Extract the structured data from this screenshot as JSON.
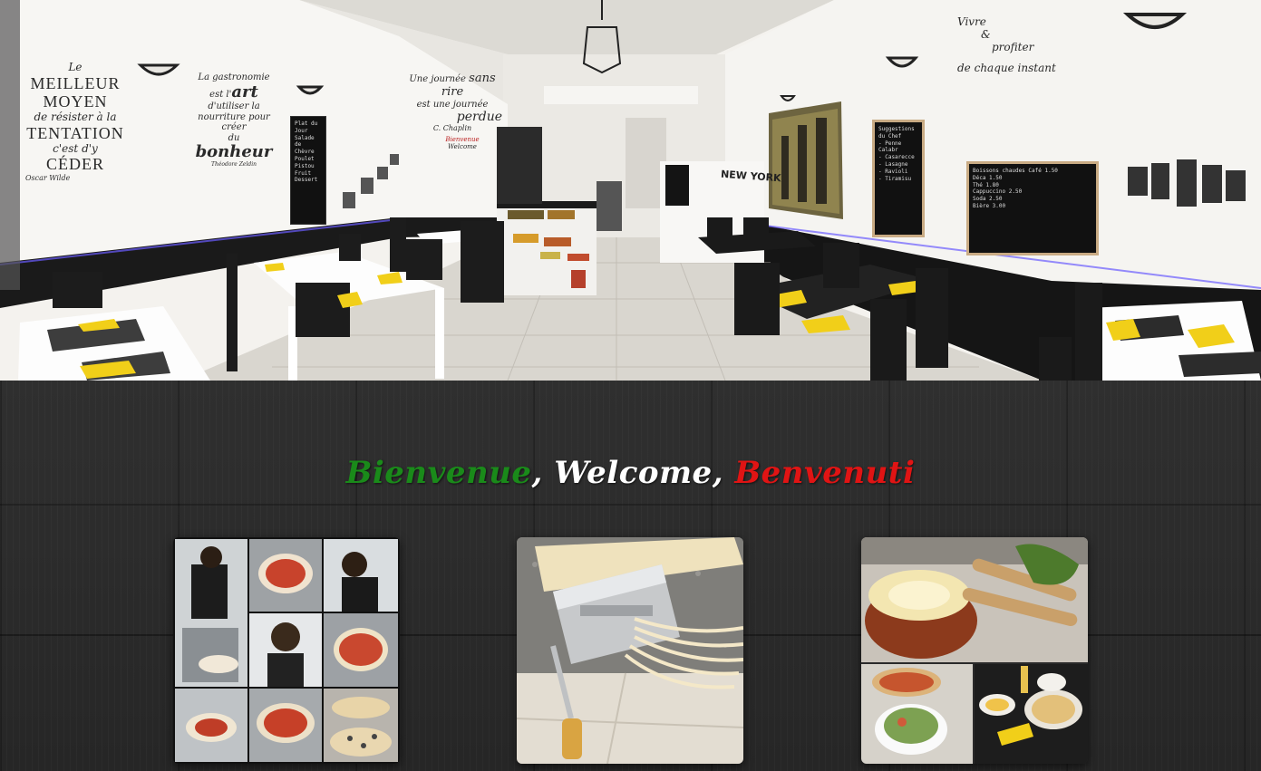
{
  "hero": {
    "wall_text_left": [
      "Le",
      "MEILLEUR MOYEN",
      "de résister à la",
      "TENTATION",
      "c'est d'y",
      "CÉDER",
      "Oscar Wilde"
    ],
    "wall_text_gastro": [
      "La gastronomie",
      "est l'",
      "art",
      "d'utiliser la",
      "nourriture",
      "pour créer",
      "du",
      "bonheur",
      "Théodore Zeldin"
    ],
    "wall_text_sansrien": [
      "Une journée",
      "sans rire",
      "est une journée",
      "perdue",
      "C. Chaplin"
    ],
    "wall_text_vivre": [
      "Vivre",
      "&",
      "profiter",
      "de chaque instant"
    ],
    "welcome_sign": [
      "Bienvenue",
      "Welcome"
    ],
    "poster_text": "NEW YORK",
    "chalkboard_left": "Plat du Jour\nSalade\nde\nChèvre\nPoulet Pistou\nFruit Dessert",
    "chalkboard_menu": "Suggestions du Chef\n- Penne Calabr\n- Casarecce\n- Lasagne\n- Ravioli\n- Tiramisu",
    "chalkboard_drinks": "Boissons chaudes  Café 1.50\nDéca 1.50\nThé 1.80\nCappuccino 2.50\nSoda 2.50\nBière 3.00"
  },
  "welcome": {
    "part1": "Bienvenue",
    "sep1": ", ",
    "part2": "Welcome",
    "sep2": ", ",
    "part3": "Benvenuti",
    "colors": {
      "part1": "#1a8a1a",
      "part2": "#ffffff",
      "part3": "#e01414",
      "sep": "#ffffff"
    }
  },
  "gallery": [
    {
      "name": "pizza-making-collage"
    },
    {
      "name": "fresh-pasta-machine"
    },
    {
      "name": "dishes-collage"
    }
  ]
}
